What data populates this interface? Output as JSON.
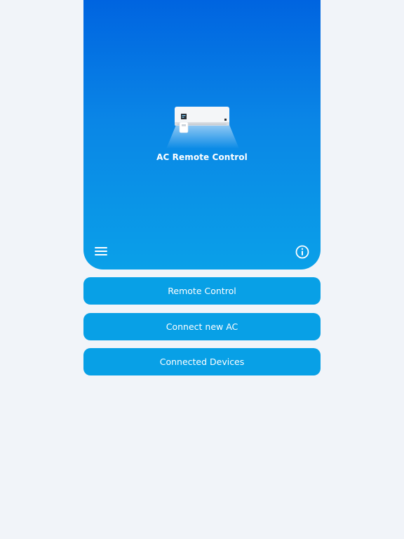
{
  "hero": {
    "title": "AC Remote Control"
  },
  "icons": {
    "menu": "hamburger-menu-icon",
    "info": "info-circle-icon",
    "illustration": "air-conditioner-illustration"
  },
  "buttons": [
    {
      "label": "Remote Control"
    },
    {
      "label": "Connect new AC"
    },
    {
      "label": "Connected Devices"
    }
  ],
  "colors": {
    "background": "#f1f4f9",
    "hero_top": "#0064e0",
    "hero_bottom": "#0aa0e8",
    "button": "#08a0e6",
    "text_on_accent": "#ffffff"
  }
}
